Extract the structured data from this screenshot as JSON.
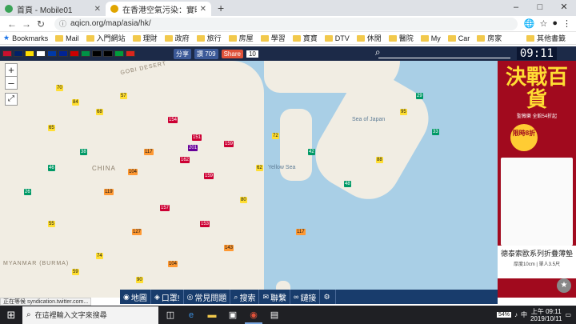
{
  "browser": {
    "tabs": [
      {
        "title": "首頁 - Mobile01",
        "active": false,
        "favicon_color": "#3aa357"
      },
      {
        "title": "在香港空氣污染：實時空氣質量指數地圖",
        "active": true,
        "favicon_color": "#e0a500"
      }
    ],
    "new_tab": "+",
    "window_controls": [
      "–",
      "□",
      "✕"
    ],
    "address": {
      "url": "aqicn.org/map/asia/hk/",
      "lock": "ⓘ"
    },
    "nav": {
      "back": "←",
      "forward": "→",
      "reload": "↻"
    },
    "bookmarks": [
      {
        "label": "Bookmarks",
        "star": true
      },
      {
        "label": "Mail"
      },
      {
        "label": "入門網站"
      },
      {
        "label": "理財"
      },
      {
        "label": "政府"
      },
      {
        "label": "旅行"
      },
      {
        "label": "房屋"
      },
      {
        "label": "學習"
      },
      {
        "label": "寶寶"
      },
      {
        "label": "DTV"
      },
      {
        "label": "休閒"
      },
      {
        "label": "醫院"
      },
      {
        "label": "My"
      },
      {
        "label": "Car"
      },
      {
        "label": "房家"
      }
    ],
    "other_bookmarks": "其他書籤"
  },
  "site": {
    "facebook": {
      "share": "分享",
      "like": "讚 709"
    },
    "share": {
      "label": "Share",
      "count": "10"
    },
    "clock": "09:11",
    "flag_colors": [
      "#c8102e",
      "#012169",
      "#ffde00",
      "#ffffff",
      "#0039a6",
      "#002395",
      "#cc0001",
      "#009246",
      "#000000",
      "#000000",
      "#009c3b",
      "#da251d"
    ]
  },
  "map": {
    "zoom_in": "+",
    "zoom_out": "–",
    "fullscreen": "⤢",
    "country_label": "CHINA",
    "region_labels": [
      "GOBI DESERT",
      "MYANMAR (BURMA)"
    ],
    "sea_labels": [
      "Sea of Japan",
      "Yellow Sea"
    ],
    "aqi_colors": {
      "good": "#009966",
      "moderate": "#ffde33",
      "usg": "#ff9933",
      "unhealthy": "#cc0033",
      "very_unhealthy": "#660099"
    },
    "stations": [
      {
        "aqi": "70",
        "level": "moderate"
      },
      {
        "aqi": "84",
        "level": "moderate"
      },
      {
        "aqi": "68",
        "level": "moderate"
      },
      {
        "aqi": "57",
        "level": "moderate"
      },
      {
        "aqi": "65",
        "level": "moderate"
      },
      {
        "aqi": "154",
        "level": "unhealthy"
      },
      {
        "aqi": "151",
        "level": "unhealthy"
      },
      {
        "aqi": "162",
        "level": "unhealthy"
      },
      {
        "aqi": "159",
        "level": "unhealthy"
      },
      {
        "aqi": "201",
        "level": "very_unhealthy"
      },
      {
        "aqi": "117",
        "level": "usg"
      },
      {
        "aqi": "104",
        "level": "usg"
      },
      {
        "aqi": "38",
        "level": "good"
      },
      {
        "aqi": "46",
        "level": "good"
      },
      {
        "aqi": "26",
        "level": "good"
      },
      {
        "aqi": "42",
        "level": "good"
      },
      {
        "aqi": "48",
        "level": "good"
      },
      {
        "aqi": "88",
        "level": "moderate"
      },
      {
        "aqi": "95",
        "level": "moderate"
      },
      {
        "aqi": "157",
        "level": "unhealthy"
      },
      {
        "aqi": "119",
        "level": "usg"
      },
      {
        "aqi": "127",
        "level": "usg"
      },
      {
        "aqi": "153",
        "level": "unhealthy"
      },
      {
        "aqi": "74",
        "level": "moderate"
      },
      {
        "aqi": "59",
        "level": "moderate"
      },
      {
        "aqi": "55",
        "level": "moderate"
      },
      {
        "aqi": "143",
        "level": "usg"
      },
      {
        "aqi": "80",
        "level": "moderate"
      },
      {
        "aqi": "62",
        "level": "moderate"
      },
      {
        "aqi": "117",
        "level": "usg"
      },
      {
        "aqi": "29",
        "level": "good"
      },
      {
        "aqi": "33",
        "level": "good"
      },
      {
        "aqi": "72",
        "level": "moderate"
      },
      {
        "aqi": "159",
        "level": "unhealthy"
      },
      {
        "aqi": "104",
        "level": "usg"
      },
      {
        "aqi": "90",
        "level": "moderate"
      }
    ]
  },
  "ad": {
    "headline": "決戰百貨",
    "subline": "聖薇樂 全館54折起",
    "badge": "限時8折",
    "product_name": "德泰索歐系列折疊薄墊",
    "product_spec": "厚度10cm | 單人3.5尺",
    "fab": "★"
  },
  "site_nav": [
    {
      "label": "地圖",
      "icon": "◉"
    },
    {
      "label": "口罩!",
      "icon": "◈"
    },
    {
      "label": "常見問題",
      "icon": "◎"
    },
    {
      "label": "搜索",
      "icon": "⌕"
    },
    {
      "label": "聯繫",
      "icon": "✉"
    },
    {
      "label": "鏈接",
      "icon": "∞"
    },
    {
      "label": "",
      "icon": "⚙"
    }
  ],
  "status_text": "正在等候 syndication.twitter.com...",
  "taskbar": {
    "search_placeholder": "在這裡輸入文字來搜尋",
    "battery": "54%",
    "time": "上午 09:11",
    "date": "2019/10/11",
    "lang": "中"
  }
}
